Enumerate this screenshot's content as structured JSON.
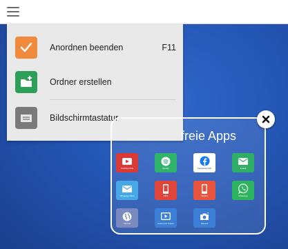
{
  "menu": {
    "items": [
      {
        "label": "Anordnen beenden",
        "shortcut": "F11",
        "color": "#f08a3c"
      },
      {
        "label": "Ordner erstellen",
        "shortcut": "",
        "color": "#2e9f58"
      },
      {
        "label": "Bildschirmtastatur",
        "shortcut": "",
        "color": "#7a7a7a"
      }
    ]
  },
  "folder": {
    "title": "freie Apps",
    "apps": [
      {
        "label": "YouTube Kids",
        "color": "#d93a36",
        "icon": "play-icon"
      },
      {
        "label": "Spotify",
        "color": "#2fb36b",
        "icon": "spotify-icon"
      },
      {
        "label": "Facebook Kids",
        "color": "#ffffff",
        "icon": "facebook-icon"
      },
      {
        "label": "E-Mail",
        "color": "#2fae65",
        "icon": "mail-icon"
      },
      {
        "label": "WhatsApp Web",
        "color": "#46a8e6",
        "icon": "mail-icon"
      },
      {
        "label": "SMS",
        "color": "#e0453c",
        "icon": "phone-icon"
      },
      {
        "label": "Telefon",
        "color": "#e8553e",
        "icon": "phone-icon"
      },
      {
        "label": "WhatsApp",
        "color": "#2cb45e",
        "icon": "whatsapp-icon"
      },
      {
        "label": "Internet",
        "color": "#7b8bbf",
        "icon": "globe-icon"
      },
      {
        "label": "Fotos und Videos",
        "color": "#3a7ed8",
        "icon": "video-icon"
      },
      {
        "label": "Kamera",
        "color": "#3a7ed8",
        "icon": "camera-icon"
      }
    ]
  }
}
